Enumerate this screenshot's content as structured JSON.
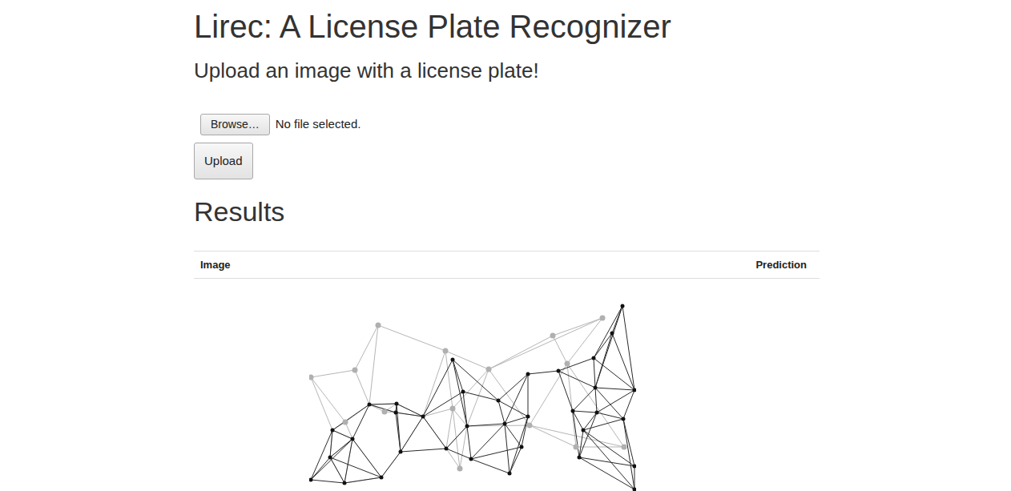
{
  "page": {
    "title": "Lirec: A License Plate Recognizer",
    "subtitle": "Upload an image with a license plate!"
  },
  "upload": {
    "browse_button": "Browse…",
    "file_status": "No file selected.",
    "submit_button": "Upload"
  },
  "results": {
    "heading": "Results",
    "columns": [
      "Image",
      "Prediction"
    ],
    "rows": [
      {
        "prediction": ""
      }
    ]
  }
}
